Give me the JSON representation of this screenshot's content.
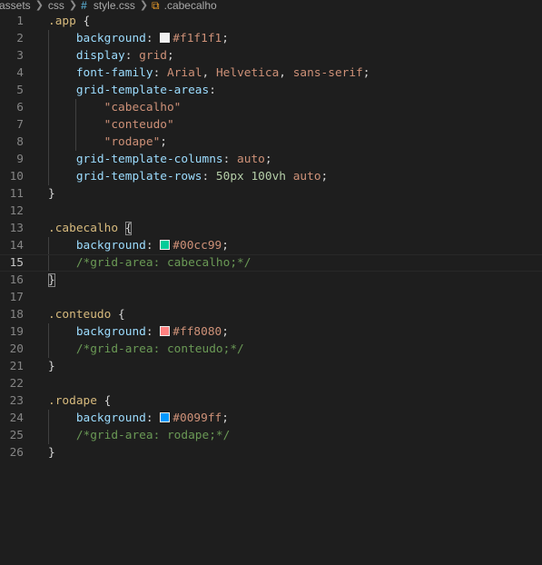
{
  "breadcrumb": {
    "segments": [
      "assets",
      "css",
      "style.css",
      ".cabecalho"
    ],
    "file_icon": "hash-icon",
    "symbol_icon": "css-selector-icon"
  },
  "editor": {
    "active_line": 15,
    "swatch_colors": {
      "app": "#f1f1f1",
      "cabecalho": "#00cc99",
      "conteudo": "#ff8080",
      "rodape": "#0099ff"
    },
    "lines": [
      {
        "n": "1",
        "tokens": [
          {
            "t": ".app",
            "c": "sel"
          },
          {
            "t": " {",
            "c": "punc"
          }
        ]
      },
      {
        "n": "2",
        "tokens": [
          {
            "t": "    background",
            "c": "prop"
          },
          {
            "t": ": ",
            "c": "punc"
          },
          {
            "swatch": "#f1f1f1"
          },
          {
            "t": "#f1f1f1",
            "c": "val"
          },
          {
            "t": ";",
            "c": "punc"
          }
        ]
      },
      {
        "n": "3",
        "tokens": [
          {
            "t": "    display",
            "c": "prop"
          },
          {
            "t": ": ",
            "c": "punc"
          },
          {
            "t": "grid",
            "c": "val"
          },
          {
            "t": ";",
            "c": "punc"
          }
        ]
      },
      {
        "n": "4",
        "tokens": [
          {
            "t": "    font-family",
            "c": "prop"
          },
          {
            "t": ": ",
            "c": "punc"
          },
          {
            "t": "Arial",
            "c": "val"
          },
          {
            "t": ", ",
            "c": "punc"
          },
          {
            "t": "Helvetica",
            "c": "val"
          },
          {
            "t": ", ",
            "c": "punc"
          },
          {
            "t": "sans-serif",
            "c": "val"
          },
          {
            "t": ";",
            "c": "punc"
          }
        ]
      },
      {
        "n": "5",
        "tokens": [
          {
            "t": "    grid-template-areas",
            "c": "prop"
          },
          {
            "t": ":",
            "c": "punc"
          }
        ]
      },
      {
        "n": "6",
        "tokens": [
          {
            "t": "        \"cabecalho\"",
            "c": "val"
          }
        ]
      },
      {
        "n": "7",
        "tokens": [
          {
            "t": "        \"conteudo\"",
            "c": "val"
          }
        ]
      },
      {
        "n": "8",
        "tokens": [
          {
            "t": "        \"rodape\"",
            "c": "val"
          },
          {
            "t": ";",
            "c": "punc"
          }
        ]
      },
      {
        "n": "9",
        "tokens": [
          {
            "t": "    grid-template-columns",
            "c": "prop"
          },
          {
            "t": ": ",
            "c": "punc"
          },
          {
            "t": "auto",
            "c": "val"
          },
          {
            "t": ";",
            "c": "punc"
          }
        ]
      },
      {
        "n": "10",
        "tokens": [
          {
            "t": "    grid-template-rows",
            "c": "prop"
          },
          {
            "t": ": ",
            "c": "punc"
          },
          {
            "t": "50px",
            "c": "num"
          },
          {
            "t": " ",
            "c": "punc"
          },
          {
            "t": "100vh",
            "c": "num"
          },
          {
            "t": " ",
            "c": "punc"
          },
          {
            "t": "auto",
            "c": "val"
          },
          {
            "t": ";",
            "c": "punc"
          }
        ]
      },
      {
        "n": "11",
        "tokens": [
          {
            "t": "}",
            "c": "punc"
          }
        ]
      },
      {
        "n": "12",
        "tokens": []
      },
      {
        "n": "13",
        "tokens": [
          {
            "t": ".cabecalho",
            "c": "sel"
          },
          {
            "t": " ",
            "c": "punc"
          },
          {
            "t": "{",
            "c": "punc",
            "match": true
          }
        ]
      },
      {
        "n": "14",
        "tokens": [
          {
            "t": "    background",
            "c": "prop"
          },
          {
            "t": ": ",
            "c": "punc"
          },
          {
            "swatch": "#00cc99"
          },
          {
            "t": "#00cc99",
            "c": "val"
          },
          {
            "t": ";",
            "c": "punc"
          }
        ]
      },
      {
        "n": "15",
        "tokens": [
          {
            "t": "    /*grid-area: cabecalho;*/",
            "c": "cmt"
          }
        ]
      },
      {
        "n": "16",
        "tokens": [
          {
            "t": "}",
            "c": "punc",
            "match": true
          }
        ]
      },
      {
        "n": "17",
        "tokens": []
      },
      {
        "n": "18",
        "tokens": [
          {
            "t": ".conteudo",
            "c": "sel"
          },
          {
            "t": " {",
            "c": "punc"
          }
        ]
      },
      {
        "n": "19",
        "tokens": [
          {
            "t": "    background",
            "c": "prop"
          },
          {
            "t": ": ",
            "c": "punc"
          },
          {
            "swatch": "#ff8080"
          },
          {
            "t": "#ff8080",
            "c": "val"
          },
          {
            "t": ";",
            "c": "punc"
          }
        ]
      },
      {
        "n": "20",
        "tokens": [
          {
            "t": "    /*grid-area: conteudo;*/",
            "c": "cmt"
          }
        ]
      },
      {
        "n": "21",
        "tokens": [
          {
            "t": "}",
            "c": "punc"
          }
        ]
      },
      {
        "n": "22",
        "tokens": []
      },
      {
        "n": "23",
        "tokens": [
          {
            "t": ".rodape",
            "c": "sel"
          },
          {
            "t": " {",
            "c": "punc"
          }
        ]
      },
      {
        "n": "24",
        "tokens": [
          {
            "t": "    background",
            "c": "prop"
          },
          {
            "t": ": ",
            "c": "punc"
          },
          {
            "swatch": "#0099ff"
          },
          {
            "t": "#0099ff",
            "c": "val"
          },
          {
            "t": ";",
            "c": "punc"
          }
        ]
      },
      {
        "n": "25",
        "tokens": [
          {
            "t": "    /*grid-area: rodape;*/",
            "c": "cmt"
          }
        ]
      },
      {
        "n": "26",
        "tokens": [
          {
            "t": "}",
            "c": "punc"
          }
        ]
      }
    ]
  }
}
